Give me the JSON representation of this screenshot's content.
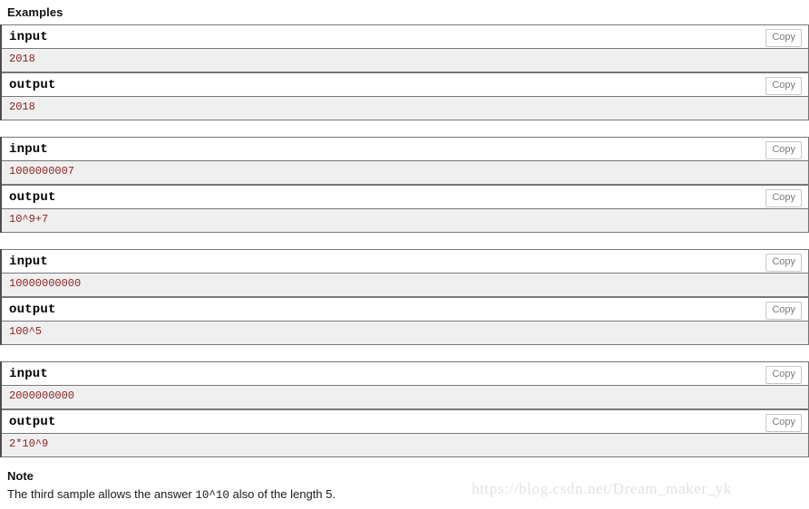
{
  "examples": {
    "heading": "Examples",
    "copy_label": "Copy",
    "input_label": "input",
    "output_label": "output",
    "tests": [
      {
        "input": "2018",
        "output": "2018"
      },
      {
        "input": "1000000007",
        "output": "10^9+7"
      },
      {
        "input": "10000000000",
        "output": "100^5"
      },
      {
        "input": "2000000000",
        "output": "2*10^9"
      }
    ]
  },
  "note": {
    "heading": "Note",
    "text_before": "The third sample allows the answer ",
    "code": "10^10",
    "text_after": " also of the length 5."
  },
  "watermark": {
    "text": "https://blog.csdn.net/Dream_maker_yk"
  },
  "colors": {
    "value_text": "#8b2323",
    "block_border": "#777777",
    "block_left_border": "#4d4d4d",
    "value_background": "#efefef",
    "copy_button_text": "#7a7a7a",
    "copy_button_border": "#c6c6c6",
    "watermark": "#e2e2e2"
  }
}
